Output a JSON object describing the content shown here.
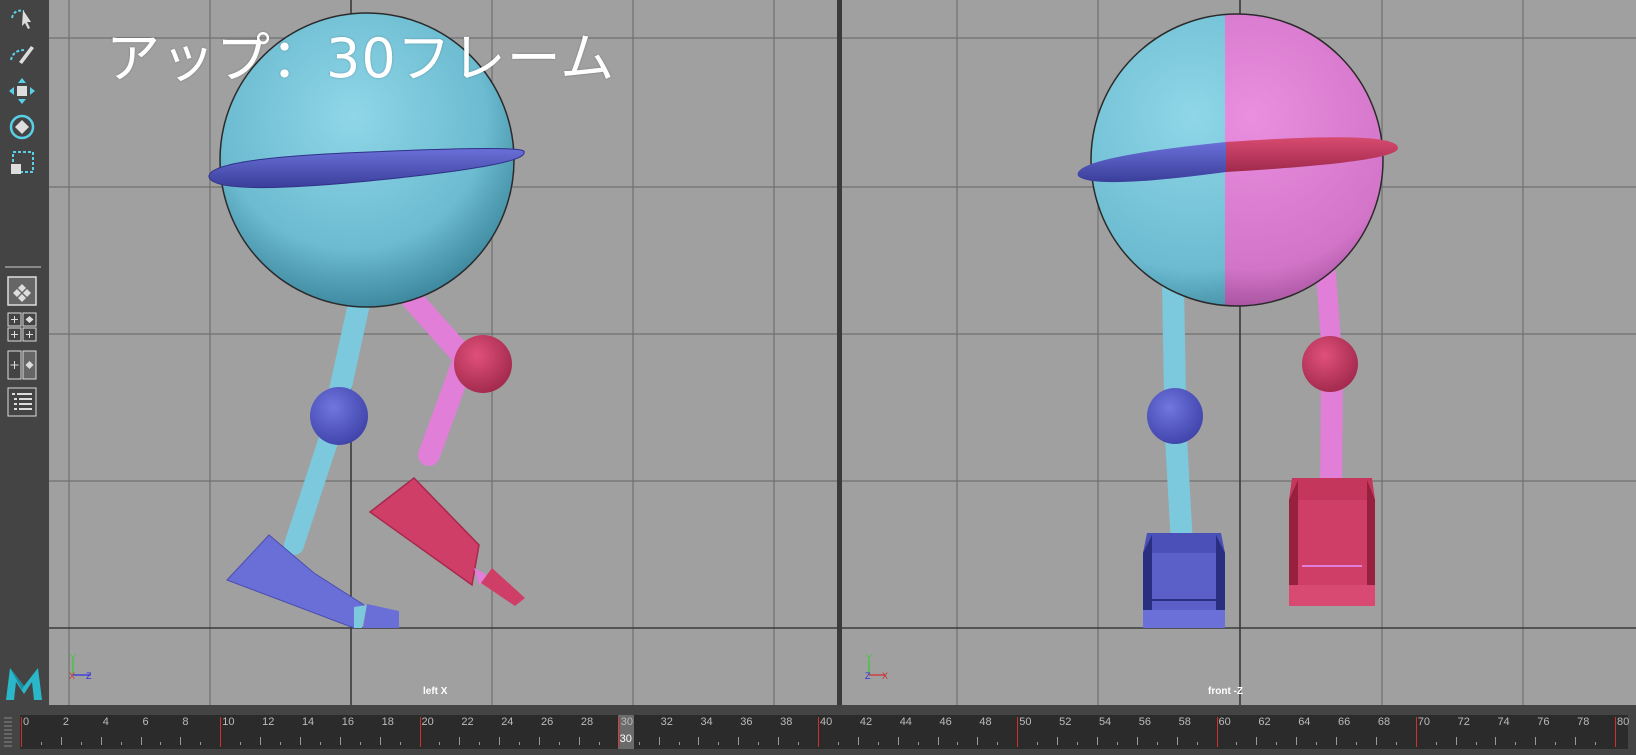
{
  "overlay": {
    "title": "アップ：30フレーム"
  },
  "viewports": {
    "left": {
      "label": "left X",
      "axis": {
        "up": "Y",
        "h1": "X",
        "h2": "Z"
      }
    },
    "right": {
      "label": "front -Z",
      "axis": {
        "up": "Y",
        "h1": "Z",
        "h2": "X"
      }
    }
  },
  "timeline": {
    "start": 0,
    "end": 80,
    "current_frame": 30,
    "current_frame_label": "30",
    "labels": [
      "0",
      "2",
      "4",
      "6",
      "8",
      "10",
      "12",
      "14",
      "16",
      "18",
      "20",
      "22",
      "24",
      "26",
      "28",
      "30",
      "32",
      "34",
      "36",
      "38",
      "40",
      "42",
      "44",
      "46",
      "48",
      "50",
      "52",
      "54",
      "56",
      "58",
      "60",
      "62",
      "64",
      "66",
      "68",
      "70",
      "72",
      "74",
      "76",
      "78",
      "80"
    ]
  },
  "toolbox": {
    "tools": [
      "lasso-select-icon",
      "paint-select-icon",
      "move-icon",
      "rotate-icon",
      "scale-icon"
    ],
    "layouts": [
      "single-view-icon",
      "four-view-icon",
      "two-view-icon",
      "outliner-icon"
    ]
  },
  "colors": {
    "viewport_bg": "#a0a0a0",
    "grid": "#6e6e6e",
    "cyan": "#7cc8dc",
    "pink": "#e07ed8",
    "blue_ring": "#5a5ec8",
    "red_ring": "#c83860",
    "blue_joint": "#5a60c8",
    "red_joint": "#c83860"
  }
}
